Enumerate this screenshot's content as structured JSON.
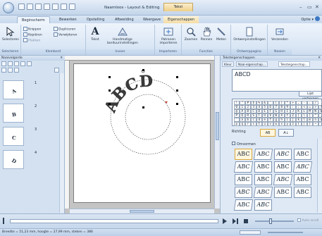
{
  "title_bar": {
    "title": "Naamloos - Layout & Editing",
    "context_tab": "Tekst",
    "window_controls": [
      "–",
      "▭",
      "✕"
    ]
  },
  "tabs": [
    "Beginscherm",
    "Bewerken",
    "Opstelling",
    "Afbeelding",
    "Weergave",
    "Eigenschappen"
  ],
  "active_tab": "Beginscherm",
  "options_label": "Optie",
  "ribbon": {
    "groups": {
      "selecteren": "Selecteren",
      "klembord": "Klembord",
      "invoer": "Invoer",
      "importeren": "Importeren",
      "functies": "Functies",
      "ontwerppagina": "Ontwerppagina",
      "naaien": "Naaien"
    },
    "buttons": {
      "selecteren": "Selecteren",
      "knippen": "Knippen",
      "kopiëren": "Kopiëren",
      "plakken": "Plakken",
      "dupliceren": "Dupliceren",
      "verwijderen": "Verwijderen",
      "tekst": "Tekst",
      "handmatige": "Handmatige borduurinstellingen",
      "patronen": "Patronen importeren",
      "zoomen": "Zoomen",
      "pannen": "Pannen",
      "meten": "Meten",
      "ontwerpinstellingen": "Ontwerpinstellingen",
      "verzenden": "Verzenden"
    }
  },
  "left_panel": {
    "title": "Naaivolgorde",
    "items": [
      {
        "num": "1",
        "letter": "A"
      },
      {
        "num": "2",
        "letter": "B"
      },
      {
        "num": "3",
        "letter": "C"
      },
      {
        "num": "4",
        "letter": "D"
      }
    ]
  },
  "canvas": {
    "text": "ABCD"
  },
  "right_panel": {
    "title": "Teksteigenschappen",
    "tabs": [
      "Kleur",
      "Naai-eigenschap...",
      "Teksteigenschap..."
    ],
    "text_value": "ABCD",
    "hide_button": "Lijst verbergen",
    "charmap_rows": [
      [
        "!",
        "\"",
        "#",
        "$",
        "%",
        "&",
        "'",
        "(",
        ")",
        "*",
        "+",
        ",",
        "-",
        ".",
        "/"
      ],
      [
        "0",
        "1",
        "2",
        "3",
        "4",
        "5",
        "6",
        "7",
        "8",
        "9",
        ":",
        ";",
        "<",
        "=",
        ">",
        "?"
      ],
      [
        "@",
        "A",
        "B",
        "C",
        "D",
        "E",
        "F",
        "G",
        "H",
        "I",
        "J",
        "K",
        "L",
        "M",
        "N",
        "O"
      ],
      [
        "P",
        "Q",
        "R",
        "S",
        "T",
        "U",
        "V",
        "W",
        "X",
        "Y",
        "Z",
        "[",
        "\\",
        "]",
        "^",
        "_"
      ],
      [
        "`",
        "a",
        "b",
        "c",
        "d",
        "e",
        "f",
        "g",
        "h",
        "i",
        "j",
        "k",
        "l",
        "m",
        "n",
        "o"
      ],
      [
        "p",
        "q",
        "r",
        "s",
        "t",
        "u",
        "v",
        "w",
        "x",
        "y",
        "z",
        "{",
        "|",
        "}",
        "~",
        ""
      ]
    ],
    "direction_label": "Richting",
    "direction_buttons": [
      "AB",
      "A↓"
    ],
    "transform_label": "Omvormen",
    "shapes": [
      "ABC",
      "ABC",
      "ABC",
      "ABC",
      "ABC",
      "ABC",
      "ABC",
      "ABC",
      "ABC",
      "ABC",
      "ABC",
      "ABC",
      "ABC",
      "ABC",
      "ABC",
      "ABC",
      "ABC",
      "ABC"
    ]
  },
  "playback": {
    "auto_scroll": "Auto-scroll"
  },
  "status": {
    "text": "Breedte = 51,23 mm, hoogte = 27,99 mm, steken = 386"
  }
}
